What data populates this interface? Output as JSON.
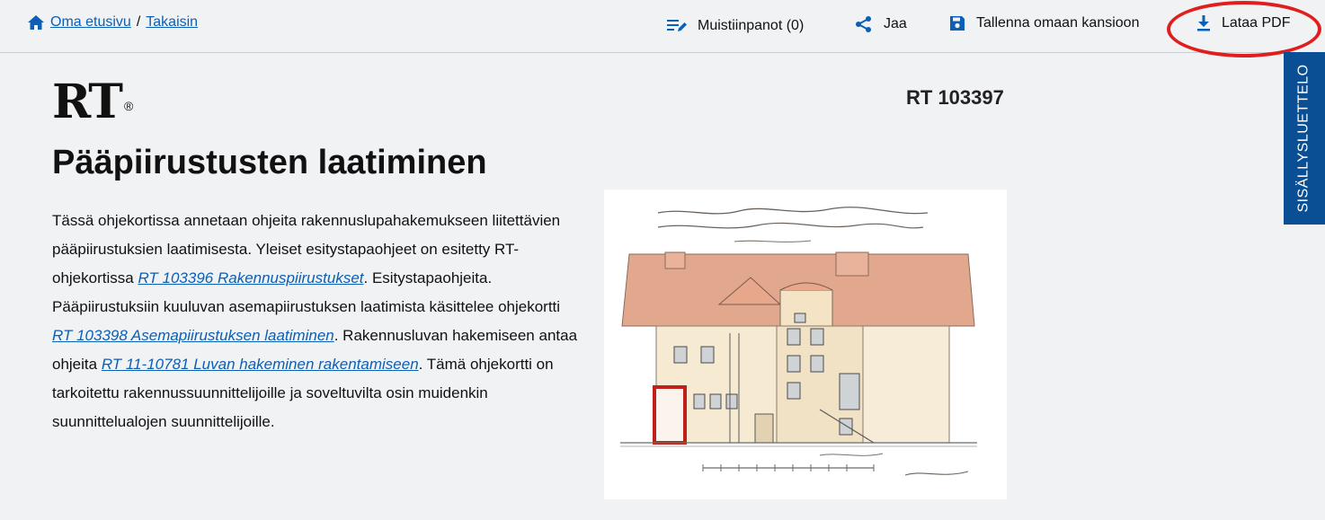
{
  "breadcrumb": {
    "home": "Oma etusivu",
    "separator": "/",
    "back": "Takaisin"
  },
  "toolbar": {
    "notes": "Muistiinpanot (0)",
    "share": "Jaa",
    "save": "Tallenna omaan kansioon",
    "pdf": "Lataa PDF"
  },
  "toc_tab": "SISÄLLYSLUETTELO",
  "logo": {
    "text": "RT",
    "mark": "®"
  },
  "doc_code": "RT 103397",
  "title": "Pääpiirustusten laatiminen",
  "intro": {
    "p1": "Tässä ohjekortissa annetaan ohjeita rakennuslupahakemukseen liitettävien pääpiirustuksien laatimisesta. Yleiset esitystapaohjeet on esitetty RT-ohjekortissa ",
    "link1": "RT 103396 Rakennuspiirustukset",
    "p2": ". Esitystapaohjeita. Pääpiirustuksiin kuuluvan asemapiirustuksen laatimista käsittelee ohjekortti ",
    "link2": "RT 103398 Asemapiirustuksen laatiminen",
    "p3": ". Rakennusluvan hakemiseen antaa ohjeita ",
    "link3": "RT 11-10781 Luvan hakeminen rakentamiseen",
    "p4": ". Tämä ohjekortti on tarkoitettu rakennussuunnittelijoille ja soveltuvilta osin muidenkin suunnittelualojen suunnittelijoille."
  },
  "colors": {
    "link": "#0b5fb5",
    "toc_tab": "#0a4f94",
    "highlight_ring": "#e01e1e"
  },
  "icons": [
    "home-icon",
    "notes-icon",
    "share-icon",
    "save-icon",
    "download-icon"
  ]
}
